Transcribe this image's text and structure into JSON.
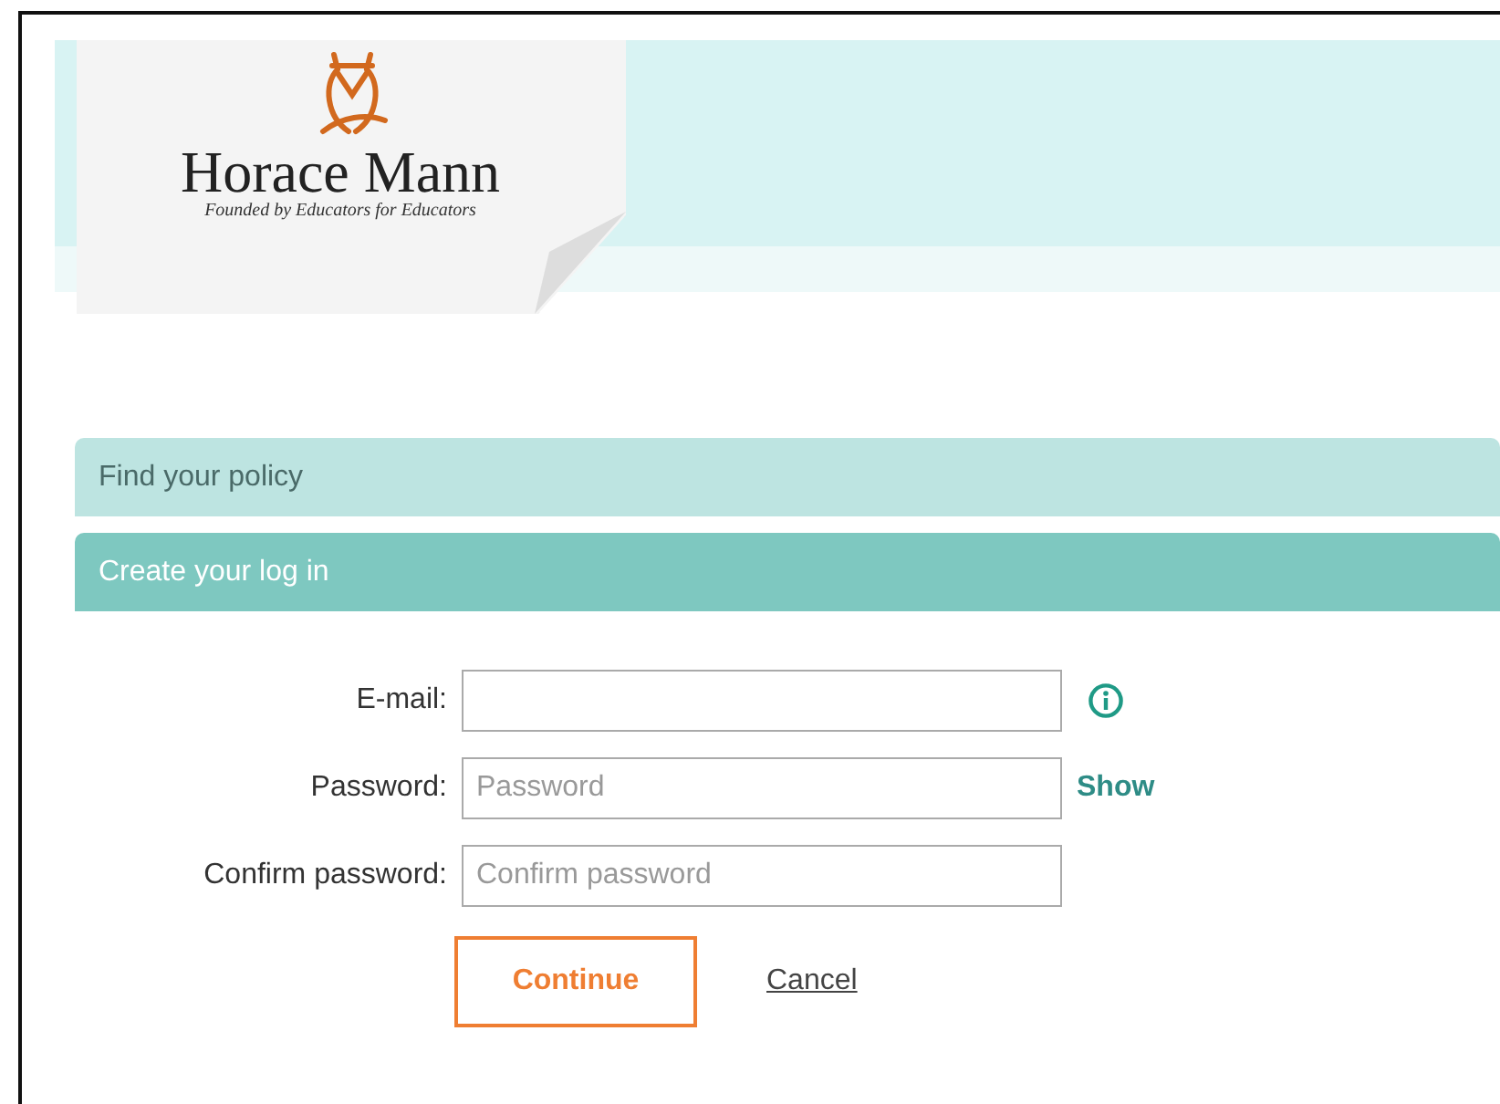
{
  "logo": {
    "name": "Horace Mann",
    "tagline": "Founded by Educators for Educators"
  },
  "sections": [
    {
      "label": "Find your policy",
      "selected": false
    },
    {
      "label": "Create your log in",
      "selected": true
    }
  ],
  "fields": [
    {
      "label": "E-mail:",
      "kind": "info"
    },
    {
      "label": "Password:",
      "placeholder": "Password",
      "kind": "reveal",
      "action": "Show"
    },
    {
      "label": "Confirm password:",
      "placeholder": "Confirm password",
      "kind": "plain"
    }
  ],
  "buttons": {
    "primary": "Continue",
    "secondary": "Cancel"
  }
}
